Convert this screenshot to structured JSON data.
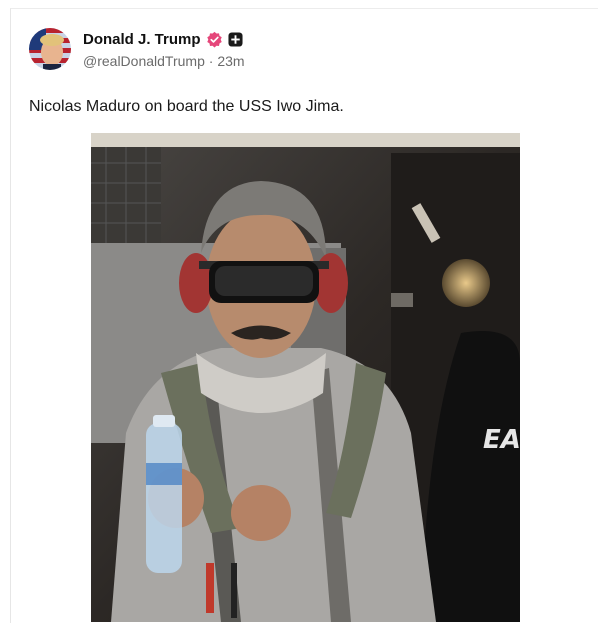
{
  "post": {
    "author": {
      "display_name": "Donald J. Trump",
      "handle": "@realDonaldTrump",
      "separator": "·",
      "time_ago": "23m",
      "avatar_icon": "flag-portrait-avatar",
      "verified_icon": "verified-badge-icon",
      "verified_color": "#e5477a",
      "extra_badge_icon": "plus-badge-icon"
    },
    "text": "Nicolas Maduro on board the USS Iwo Jima.",
    "media": {
      "type": "photo",
      "partial_text_visible": "EA"
    }
  }
}
